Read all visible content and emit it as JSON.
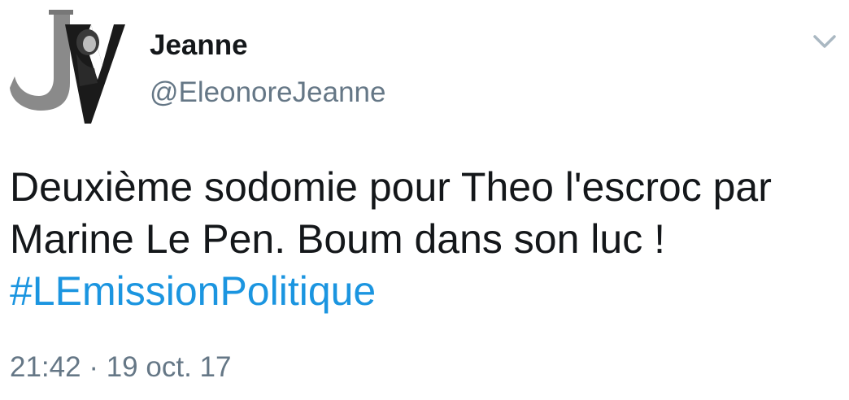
{
  "user": {
    "display_name": "Jeanne",
    "handle": "@EleonoreJeanne"
  },
  "tweet": {
    "text_before_hashtag": "Deuxième sodomie pour Theo l'escroc par Marine Le Pen. Boum dans son luc ! ",
    "hashtag": "#LEmissionPolitique",
    "time": "21:42",
    "separator": "·",
    "date": "19 oct. 17"
  },
  "icons": {
    "avatar": "jv-monogram-avatar",
    "menu": "chevron-down-icon"
  },
  "colors": {
    "text": "#14171a",
    "secondary": "#657786",
    "link": "#1b95e0",
    "background": "#ffffff"
  }
}
